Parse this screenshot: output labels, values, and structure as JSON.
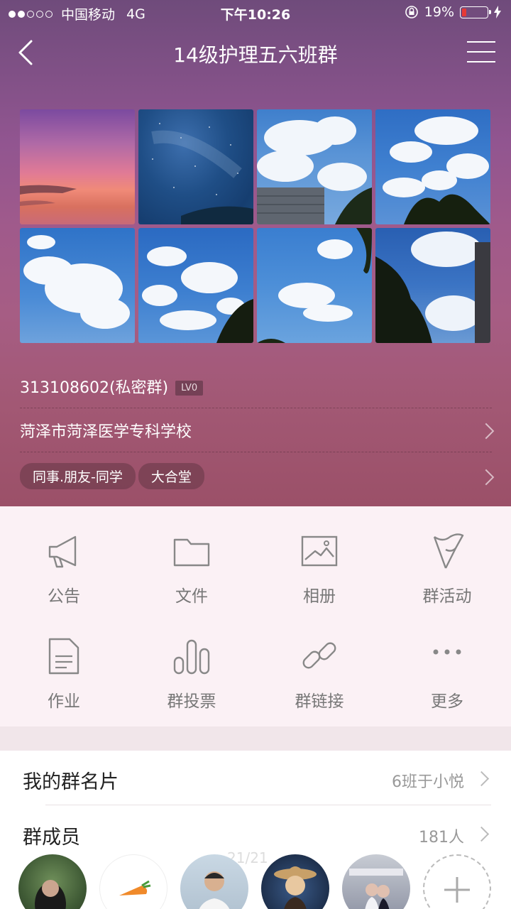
{
  "status_bar": {
    "carrier": "中国移动",
    "network": "4G",
    "time": "下午10:26",
    "battery_percent": "19%",
    "battery_level": 0.19,
    "signal_bars_filled": 2,
    "signal_bars_total": 5
  },
  "nav": {
    "title": "14级护理五六班群",
    "back_icon": "chevron-left-icon",
    "menu_icon": "hamburger-menu-icon"
  },
  "group_info": {
    "id_label": "313108602(私密群)",
    "level_badge": "LV0",
    "location": "菏泽市菏泽医学专科学校",
    "tags": [
      "同事.朋友-同学",
      "大合堂"
    ]
  },
  "functions": [
    {
      "label": "公告",
      "icon": "megaphone-icon"
    },
    {
      "label": "文件",
      "icon": "folder-icon"
    },
    {
      "label": "相册",
      "icon": "photo-icon"
    },
    {
      "label": "群活动",
      "icon": "flag-icon"
    },
    {
      "label": "作业",
      "icon": "document-icon"
    },
    {
      "label": "群投票",
      "icon": "bar-chart-icon"
    },
    {
      "label": "群链接",
      "icon": "link-icon"
    },
    {
      "label": "更多",
      "icon": "more-dots-icon"
    }
  ],
  "list": {
    "card_label": "我的群名片",
    "card_value": "6班于小悦",
    "members_label": "群成员",
    "members_value": "181人"
  },
  "page_indicator": "21/21",
  "colors": {
    "header_top": "#6f4b7b",
    "header_bottom": "#9b5068",
    "panel_bg": "#fbf1f5",
    "icon_gray": "#888888",
    "battery_low": "#e53935"
  }
}
